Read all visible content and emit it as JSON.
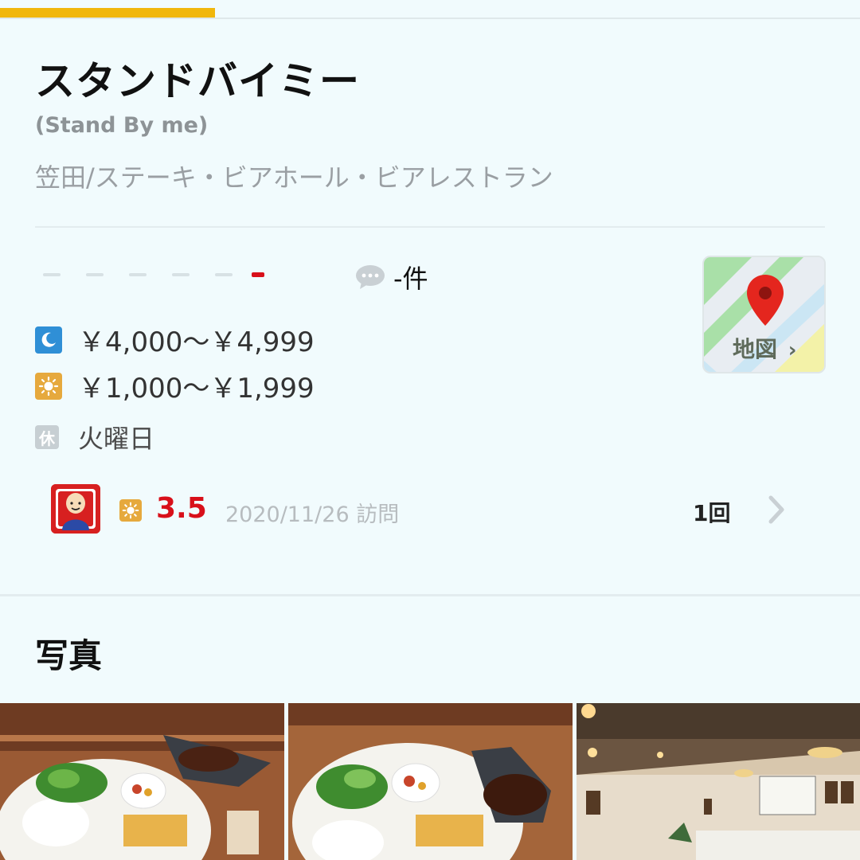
{
  "tabs": {
    "active_index": 0,
    "accent_color": "#f1b70c"
  },
  "restaurant": {
    "name": "スタンドバイミー",
    "name_en": "(Stand By me)",
    "category": "笠田/ステーキ・ビアホール・ビアレストラン"
  },
  "rating": {
    "display": "-",
    "review_count": "-件",
    "review_icon": "speech-bubble-icon"
  },
  "prices": {
    "dinner": {
      "icon": "moon-icon",
      "text": "￥4,000～￥4,999"
    },
    "lunch": {
      "icon": "sun-icon",
      "text": "￥1,000～￥1,999"
    }
  },
  "holiday": {
    "badge": "休",
    "text": "火曜日"
  },
  "map": {
    "label": "地図",
    "chevron": "›",
    "icon": "map-pin-icon"
  },
  "visit": {
    "avatar_icon": "user-avatar",
    "meal_icon": "sun-icon",
    "score": "3.5",
    "date": "2020/11/26 訪問",
    "count": "1回",
    "chevron": "chevron-right-icon"
  },
  "photos_section": {
    "heading": "写真",
    "photos": [
      {
        "name": "photo-food-plate-1"
      },
      {
        "name": "photo-food-plate-2"
      },
      {
        "name": "photo-interior"
      }
    ]
  },
  "colors": {
    "rating_red": "#d8101a",
    "night_blue": "#2f8fd6",
    "day_orange": "#e6a93d"
  }
}
